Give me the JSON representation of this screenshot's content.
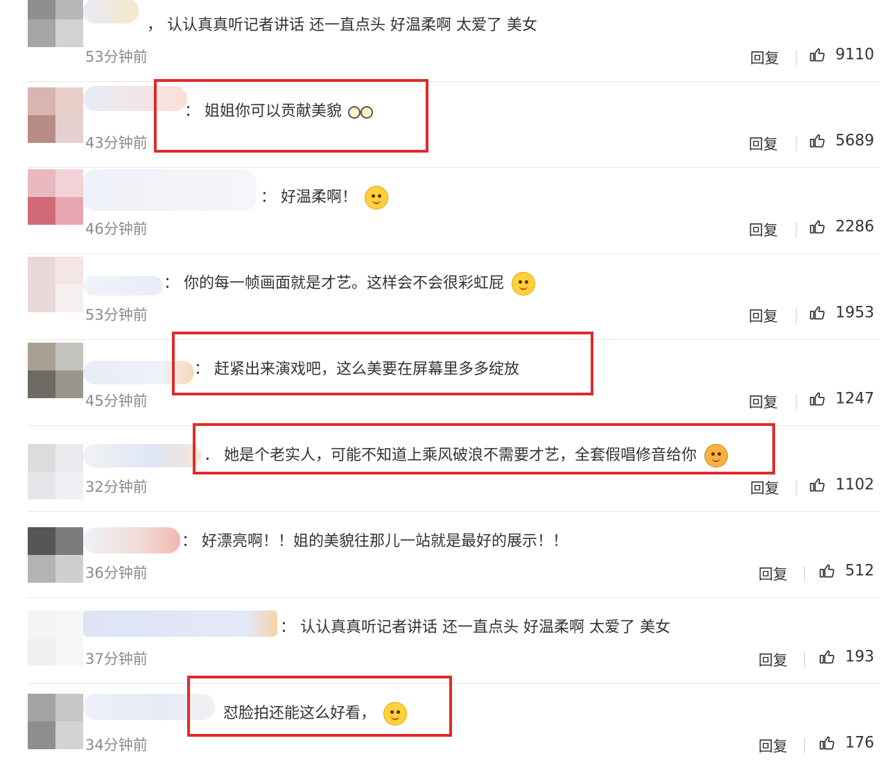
{
  "comments": [
    {
      "text": "认认真真听记者讲话 还一直点头 好温柔啊 太爱了 美女",
      "prefix": "，",
      "emoji": "",
      "time": "53分钟前",
      "reply": "回复",
      "likes": "9110"
    },
    {
      "text": "姐姐你可以贡献美貌",
      "prefix": "：",
      "emoji": "glasses-emoji",
      "time": "43分钟前",
      "reply": "回复",
      "likes": "5689"
    },
    {
      "text": "好温柔啊！",
      "prefix": "：",
      "emoji": "smile-emoji",
      "time": "46分钟前",
      "reply": "回复",
      "likes": "2286"
    },
    {
      "text": "你的每一帧画面就是才艺。这样会不会很彩虹屁",
      "prefix": "：",
      "emoji": "cat-emoji",
      "time": "53分钟前",
      "reply": "回复",
      "likes": "1953"
    },
    {
      "text": "赶紧出来演戏吧，这么美要在屏幕里多多绽放",
      "prefix": "：",
      "emoji": "",
      "time": "45分钟前",
      "reply": "回复",
      "likes": "1247"
    },
    {
      "text": "她是个老实人，可能不知道上乘风破浪不需要才艺，全套假唱修音给你",
      "prefix": "．",
      "emoji": "cat-emoji",
      "time": "32分钟前",
      "reply": "回复",
      "likes": "1102"
    },
    {
      "text": "好漂亮啊！！姐的美貌往那儿一站就是最好的展示！！",
      "prefix": "：",
      "emoji": "",
      "time": "36分钟前",
      "reply": "回复",
      "likes": "512"
    },
    {
      "text": "认认真真听记者讲话 还一直点头 好温柔啊 太爱了 美女",
      "prefix": "：",
      "emoji": "",
      "time": "37分钟前",
      "reply": "回复",
      "likes": "193"
    },
    {
      "text": "怼脸拍还能这么好看，",
      "prefix": "",
      "emoji": "smile-emoji",
      "time": "34分钟前",
      "reply": "回复",
      "likes": "176"
    }
  ],
  "colors": {
    "highlight": "#e02a2a",
    "divider": "#e6e6e6",
    "timestamp": "#8a8a8a",
    "text": "#333333"
  }
}
